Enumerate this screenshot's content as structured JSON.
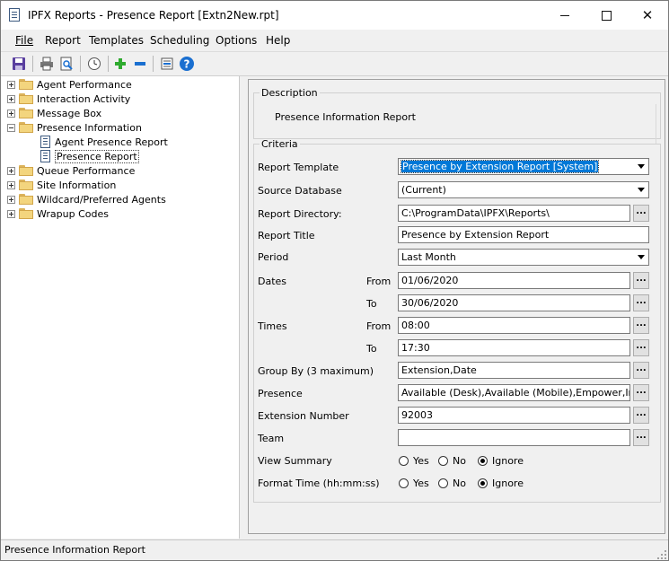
{
  "window": {
    "title": "IPFX Reports - Presence Report  [Extn2New.rpt]",
    "minimize_glyph": "—",
    "maximize_glyph": "☐",
    "close_glyph": "✕"
  },
  "menu": {
    "items": [
      {
        "label": "File",
        "underline": "F"
      },
      {
        "label": "Report",
        "underline": "R"
      },
      {
        "label": "Templates",
        "underline": "T"
      },
      {
        "label": "Scheduling",
        "underline": "S"
      },
      {
        "label": "Options",
        "underline": "O"
      },
      {
        "label": "Help",
        "underline": "H"
      }
    ]
  },
  "toolbar": {
    "icons": [
      "save-icon",
      "print-icon",
      "print-preview-icon",
      "schedule-clock-icon",
      "add-icon",
      "remove-icon",
      "settings-icon",
      "help-icon"
    ],
    "colors": {
      "add": "#2eaa2e",
      "remove": "#1a6fd0",
      "help": "#1a6fd0",
      "save": "#5a3f9f"
    }
  },
  "tree": {
    "items": [
      {
        "label": "Agent Performance",
        "level": 0,
        "kind": "folder",
        "expander": "+"
      },
      {
        "label": "Interaction Activity",
        "level": 0,
        "kind": "folder",
        "expander": "+"
      },
      {
        "label": "Message Box",
        "level": 0,
        "kind": "folder",
        "expander": "+"
      },
      {
        "label": "Presence Information",
        "level": 0,
        "kind": "folder",
        "expander": "-"
      },
      {
        "label": "Agent Presence Report",
        "level": 1,
        "kind": "report"
      },
      {
        "label": "Presence Report",
        "level": 1,
        "kind": "report",
        "selected": true
      },
      {
        "label": "Queue Performance",
        "level": 0,
        "kind": "folder",
        "expander": "+"
      },
      {
        "label": "Site Information",
        "level": 0,
        "kind": "folder",
        "expander": "+"
      },
      {
        "label": "Wildcard/Preferred Agents",
        "level": 0,
        "kind": "folder",
        "expander": "+"
      },
      {
        "label": "Wrapup Codes",
        "level": 0,
        "kind": "folder",
        "expander": "+"
      }
    ]
  },
  "description": {
    "legend": "Description",
    "text": "Presence Information Report"
  },
  "criteria": {
    "legend": "Criteria",
    "report_template": {
      "label": "Report Template",
      "value": "Presence by Extension Report [System]"
    },
    "source_database": {
      "label": "Source Database",
      "value": "(Current)"
    },
    "report_directory": {
      "label": "Report Directory:",
      "value": "C:\\ProgramData\\IPFX\\Reports\\"
    },
    "report_title": {
      "label": "Report Title",
      "value": "Presence by Extension Report"
    },
    "period": {
      "label": "Period",
      "value": "Last Month"
    },
    "dates": {
      "label": "Dates",
      "from_label": "From",
      "from_value": "01/06/2020",
      "to_label": "To",
      "to_value": "30/06/2020"
    },
    "times": {
      "label": "Times",
      "from_label": "From",
      "from_value": "08:00",
      "to_label": "To",
      "to_value": "17:30"
    },
    "group_by": {
      "label": "Group By (3 maximum)",
      "value": "Extension,Date"
    },
    "presence": {
      "label": "Presence",
      "value": "Available (Desk),Available (Mobile),Empower,In A Mee"
    },
    "extension_number": {
      "label": "Extension Number",
      "value": "92003"
    },
    "team": {
      "label": "Team",
      "value": ""
    },
    "view_summary": {
      "label": "View Summary",
      "options": [
        "Yes",
        "No",
        "Ignore"
      ],
      "selected": "Ignore"
    },
    "format_time": {
      "label": "Format Time (hh:mm:ss)",
      "options": [
        "Yes",
        "No",
        "Ignore"
      ],
      "selected": "Ignore"
    },
    "ellipsis": "..."
  },
  "status": {
    "text": "Presence Information Report"
  }
}
